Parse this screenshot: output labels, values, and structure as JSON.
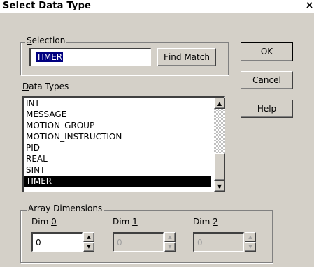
{
  "window": {
    "title": "Select Data Type",
    "close_glyph": "×"
  },
  "selection": {
    "group_label_pre": "",
    "group_label_key": "S",
    "group_label_post": "election",
    "value": "TIMER",
    "find_key": "F",
    "find_rest": "ind Match"
  },
  "data_types": {
    "label_key": "D",
    "label_rest": "ata Types",
    "items": [
      "INT",
      "MESSAGE",
      "MOTION_GROUP",
      "MOTION_INSTRUCTION",
      "PID",
      "REAL",
      "SINT",
      "TIMER"
    ],
    "selected": "TIMER"
  },
  "buttons": {
    "ok": "OK",
    "cancel": "Cancel",
    "help": "Help"
  },
  "array_dimensions": {
    "label": "Array Dimensions",
    "dims": [
      {
        "pre": "Dim ",
        "key": "0",
        "value": "0",
        "enabled": true
      },
      {
        "pre": "Dim ",
        "key": "1",
        "value": "0",
        "enabled": false
      },
      {
        "pre": "Dim ",
        "key": "2",
        "value": "0",
        "enabled": false
      }
    ]
  },
  "icons": {
    "close": "close-icon",
    "scroll_up": "up-arrow-icon",
    "scroll_down": "down-arrow-icon",
    "spin_up": "spin-up-icon",
    "spin_down": "spin-down-icon"
  }
}
